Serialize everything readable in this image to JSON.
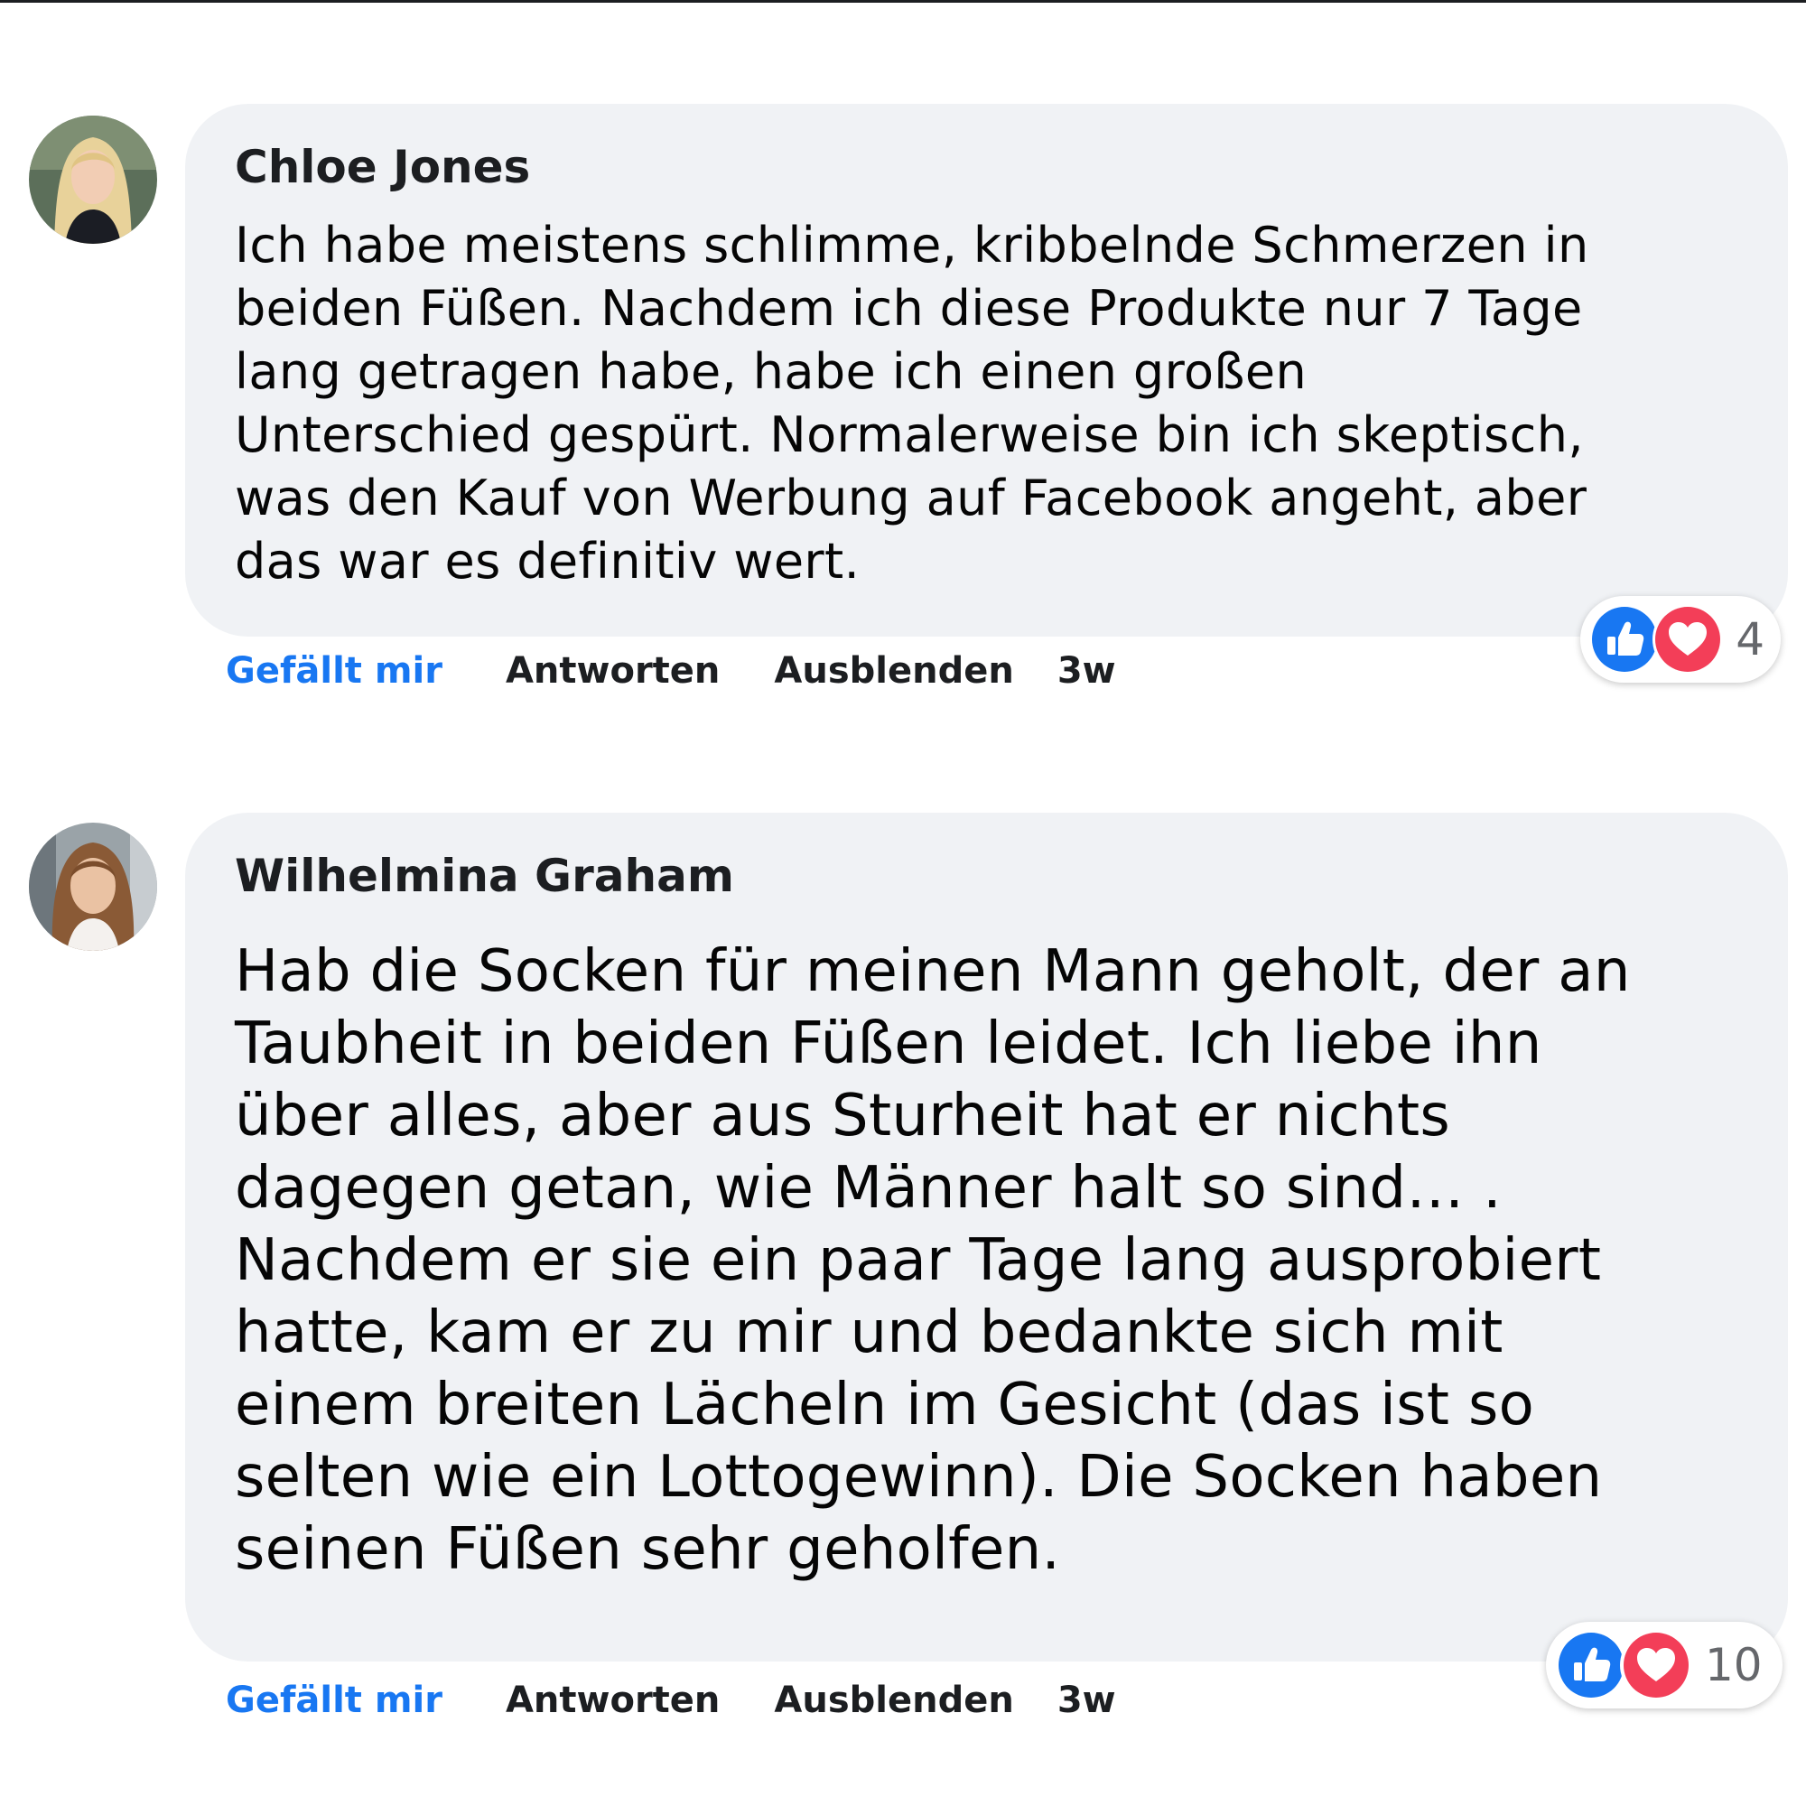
{
  "comments": [
    {
      "author": "Chloe Jones",
      "text": "Ich habe meistens schlimme, kribbelnde Schmerzen in\nbeiden Füßen. Nachdem ich diese Produkte nur 7 Tage\nlang getragen habe, habe ich einen großen\nUnterschied gespürt. Normalerweise bin ich skeptisch,\nwas den Kauf von Werbung auf Facebook angeht, aber\ndas war es definitiv wert.",
      "actions": {
        "like": "Gefällt mir",
        "reply": "Antworten",
        "hide": "Ausblenden",
        "time": "3w"
      },
      "reactions": {
        "icons": [
          "like-icon",
          "love-icon"
        ],
        "count": "4"
      }
    },
    {
      "author": "Wilhelmina Graham",
      "text": "Hab die Socken für meinen Mann geholt, der an\nTaubheit in beiden Füßen leidet. Ich liebe ihn\nüber alles, aber aus Sturheit hat er nichts\ndagegen getan, wie Männer halt so sind… .\nNachdem er sie ein paar Tage lang ausprobiert\nhatte, kam er zu mir und bedankte sich mit\neinem breiten Lächeln im Gesicht (das ist so\nselten wie ein Lottogewinn). Die Socken haben\nseinen Füßen sehr geholfen.",
      "actions": {
        "like": "Gefällt mir",
        "reply": "Antworten",
        "hide": "Ausblenden",
        "time": "3w"
      },
      "reactions": {
        "icons": [
          "like-icon",
          "love-icon"
        ],
        "count": "10"
      }
    }
  ],
  "colors": {
    "bubble": "#f0f2f5",
    "like_link": "#1877f2",
    "like_reaction": "#1877f2",
    "love_reaction": "#f33e58",
    "reaction_count": "#65676b"
  }
}
